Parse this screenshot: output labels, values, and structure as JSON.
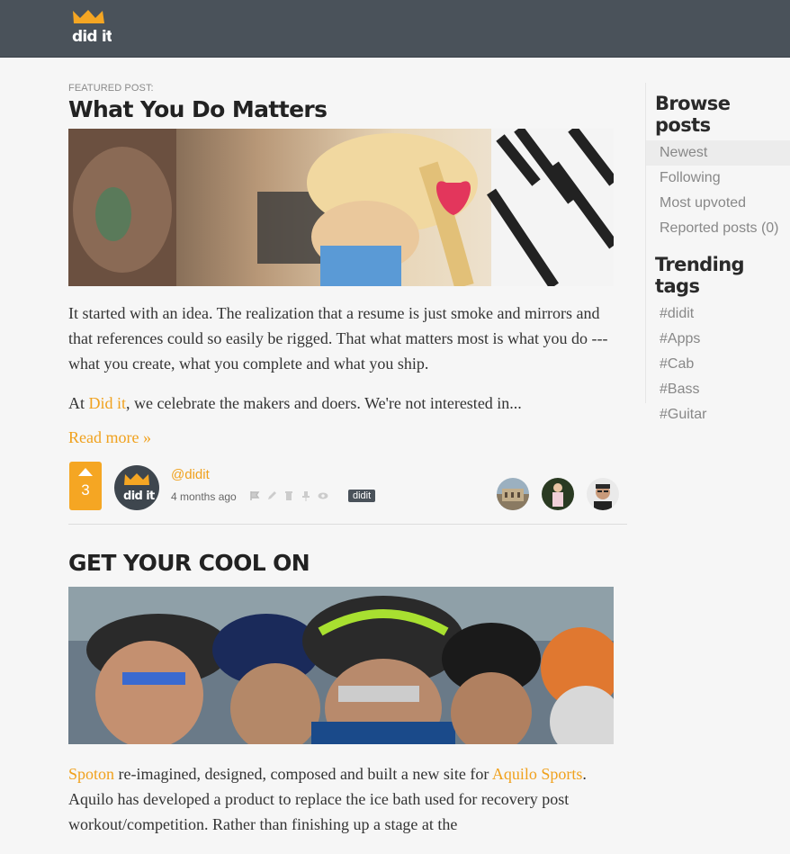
{
  "header": {
    "logo_text": "did it"
  },
  "featured": {
    "label": "FEATURED POST:",
    "title": "What You Do Matters",
    "para1": "It started with an idea. The realization that a resume is just smoke and mirrors and that references could so easily be rigged. That what matters most is what you do --- what you create, what you complete and what you ship.",
    "para2_prefix": "At ",
    "para2_link": "Did it",
    "para2_suffix": ", we celebrate the makers and doers. We're not interested in...",
    "read_more": "Read more »",
    "votes": "3",
    "author": "@didit",
    "time": "4 months ago",
    "tag": "didit",
    "actions": [
      "flag-icon",
      "pencil-icon",
      "trash-icon",
      "pin-icon",
      "eye-icon"
    ]
  },
  "post2": {
    "title": "GET YOUR COOL ON",
    "link1": "Spoton",
    "text1": " re-imagined, designed, composed and built a new site for ",
    "link2": "Aquilo Sports",
    "text2": ". Aquilo has developed a product to replace the ice bath used for recovery post workout/competition. Rather than finishing up a stage at the"
  },
  "sidebar": {
    "browse_title": "Browse posts",
    "browse_items": [
      {
        "label": "Newest",
        "active": true
      },
      {
        "label": "Following",
        "active": false
      },
      {
        "label": "Most upvoted",
        "active": false
      },
      {
        "label": "Reported posts (0)",
        "active": false
      }
    ],
    "tags_title": "Trending tags",
    "tags": [
      "#didit",
      "#Apps",
      "#Cab",
      "#Bass",
      "#Guitar"
    ]
  },
  "colors": {
    "accent": "#f0a11d",
    "topbar": "#4a525a",
    "vote": "#f5a623"
  }
}
